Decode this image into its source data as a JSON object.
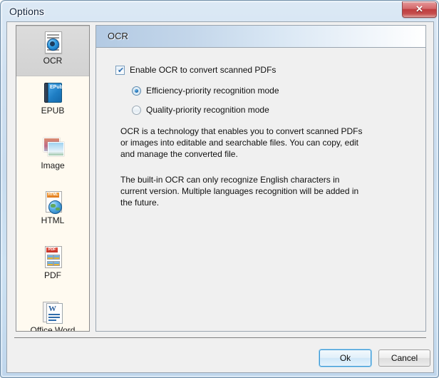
{
  "window": {
    "title": "Options",
    "close_label": "✕"
  },
  "sidebar": {
    "items": [
      {
        "label": "OCR",
        "icon": "ocr-document-icon",
        "selected": true
      },
      {
        "label": "EPUB",
        "icon": "epub-book-icon",
        "selected": false
      },
      {
        "label": "Image",
        "icon": "image-photos-icon",
        "selected": false
      },
      {
        "label": "HTML",
        "icon": "html-globe-icon",
        "selected": false
      },
      {
        "label": "PDF",
        "icon": "pdf-document-icon",
        "selected": false
      },
      {
        "label": "Office Word",
        "icon": "word-document-icon",
        "selected": false
      }
    ]
  },
  "content": {
    "section_title": "OCR",
    "enable_checkbox": {
      "label": "Enable OCR to convert scanned PDFs",
      "checked": true,
      "tick": "✔"
    },
    "modes": [
      {
        "label": "Efficiency-priority recognition mode",
        "selected": true
      },
      {
        "label": "Quality-priority recognition mode",
        "selected": false
      }
    ],
    "description_1": "OCR is a technology that enables you to convert scanned PDFs or images into editable and searchable files. You can copy, edit and manage the converted file.",
    "description_2": "The built-in OCR can only recognize English characters in current version. Multiple languages recognition will be added in the future."
  },
  "footer": {
    "ok_label": "Ok",
    "cancel_label": "Cancel"
  },
  "icon_text": {
    "epub": "EPub",
    "html": "HTML",
    "pdf": "PDF",
    "word": "W"
  },
  "colors": {
    "accent_blue": "#1f6fb5",
    "close_red": "#bf3d3f",
    "header_gradient_start": "#b3cae3",
    "sidebar_bg": "#fffaf0",
    "panel_bg": "#f0f0f0"
  }
}
